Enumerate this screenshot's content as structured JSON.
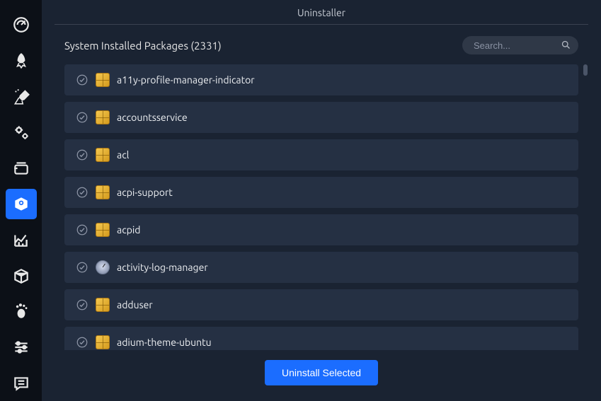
{
  "window_title": "Uninstaller",
  "section": {
    "label_prefix": "System Installed Packages",
    "count": "(2331)"
  },
  "search": {
    "placeholder": "Search..."
  },
  "packages": [
    {
      "name": "a11y-profile-manager-indicator",
      "variant": false
    },
    {
      "name": "accountsservice",
      "variant": false
    },
    {
      "name": "acl",
      "variant": false
    },
    {
      "name": "acpi-support",
      "variant": false
    },
    {
      "name": "acpid",
      "variant": false
    },
    {
      "name": "activity-log-manager",
      "variant": true
    },
    {
      "name": "adduser",
      "variant": false
    },
    {
      "name": "adium-theme-ubuntu",
      "variant": false
    }
  ],
  "footer": {
    "uninstall_label": "Uninstall Selected"
  },
  "sidebar": {
    "items": [
      {
        "id": "dashboard",
        "active": false
      },
      {
        "id": "startup",
        "active": false
      },
      {
        "id": "cleaner",
        "active": false
      },
      {
        "id": "services",
        "active": false
      },
      {
        "id": "processes",
        "active": false
      },
      {
        "id": "uninstaller",
        "active": true
      },
      {
        "id": "resources",
        "active": false
      },
      {
        "id": "packages",
        "active": false
      },
      {
        "id": "gnome",
        "active": false
      },
      {
        "id": "settings",
        "active": false
      },
      {
        "id": "logs",
        "active": false
      }
    ]
  }
}
